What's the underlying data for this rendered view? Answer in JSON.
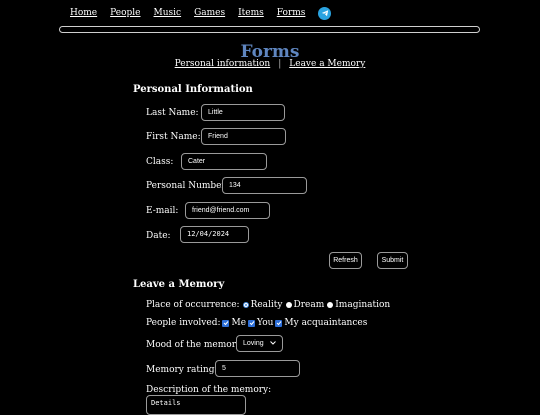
{
  "nav": {
    "home": "Home",
    "people": "People",
    "music": "Music",
    "games": "Games",
    "items": "Items",
    "forms": "Forms",
    "telegram_icon": "telegram-icon"
  },
  "page": {
    "title": "Forms",
    "sublink_personal": "Personal information",
    "separator": "|",
    "sublink_memory": "Leave a Memory"
  },
  "personal": {
    "heading": "Personal Information",
    "last_name_label": "Last Name:",
    "last_name_value": "Little",
    "first_name_label": "First Name:",
    "first_name_value": "Friend",
    "class_label": "Class:",
    "class_value": "Cater",
    "number_label": "Personal Number:",
    "number_value": "134",
    "email_label": "E-mail:",
    "email_value": "friend@friend.com",
    "date_label": "Date:",
    "date_value": "12/04/2024",
    "refresh_label": "Refresh",
    "submit_label": "Submit"
  },
  "memory": {
    "heading": "Leave a Memory",
    "occurrence_label": "Place of occurrence:",
    "occurrence_options": [
      "Reality",
      "Dream",
      "Imagination"
    ],
    "occurrence_selected": "Reality",
    "people_label": "People involved:",
    "people_options": [
      "Me",
      "You",
      "My acquaintances"
    ],
    "mood_label": "Mood of the memory:",
    "mood_value": "Loving",
    "rating_label": "Memory rating:",
    "rating_value": "5",
    "description_label": "Description of the memory:",
    "description_value": "Details"
  }
}
